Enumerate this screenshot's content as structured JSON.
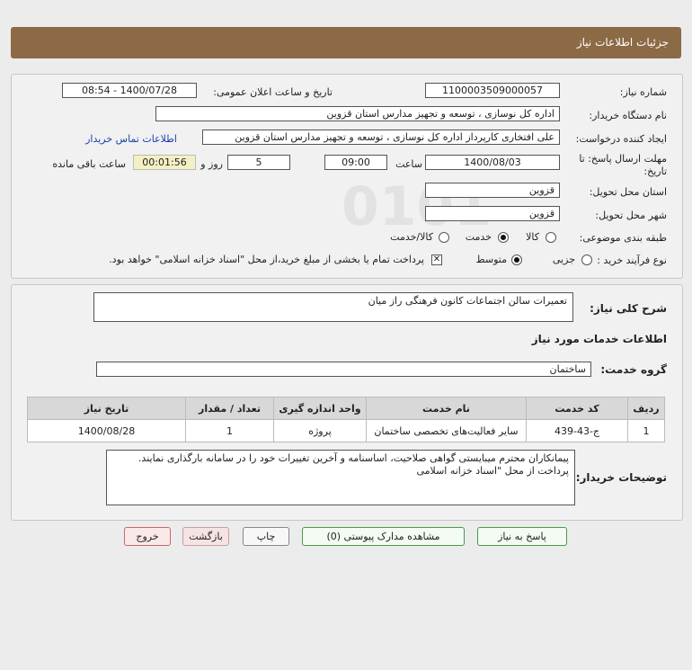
{
  "header": {
    "title": "جزئیات اطلاعات نیاز"
  },
  "form": {
    "need_number_label": "شماره نیاز:",
    "need_number": "1100003509000057",
    "announce_label": "تاریخ و ساعت اعلان عمومی:",
    "announce_value": "1400/07/28 - 08:54",
    "buyer_org_label": "نام دستگاه خریدار:",
    "buyer_org": "اداره کل نوسازی ، توسعه و تجهیز مدارس استان قزوین",
    "creator_label": "ایجاد کننده درخواست:",
    "creator": "علی افتخاری کارپرداز اداره کل نوسازی ، توسعه و تجهیز مدارس استان قزوین",
    "contact_link": "اطلاعات تماس خریدار",
    "deadline_label_1": "مهلت ارسال پاسخ: تا",
    "deadline_label_2": "تاریخ:",
    "deadline_date": "1400/08/03",
    "time_label": "ساعت",
    "deadline_time": "09:00",
    "days_value": "5",
    "days_label": "روز و",
    "remaining_time": "00:01:56",
    "remaining_label": "ساعت باقی مانده",
    "delivery_province_label": "استان محل تحویل:",
    "delivery_province": "قزوین",
    "delivery_city_label": "شهر محل تحویل:",
    "delivery_city": "قزوین",
    "category_label": "طبقه بندی موضوعی:",
    "category_options": [
      "کالا",
      "خدمت",
      "کالا/خدمت"
    ],
    "category_selected": "خدمت",
    "process_label": "نوع فرآیند خرید :",
    "process_options": [
      "جزیی",
      "متوسط"
    ],
    "process_selected": "متوسط",
    "payment_note": "پرداخت تمام یا بخشی از مبلغ خرید،از محل \"اسناد خزانه اسلامی\" خواهد بود."
  },
  "details": {
    "summary_label": "شرح کلی نیاز:",
    "summary": "تعمیرات سالن اجتماعات کانون فرهنگی راز میان",
    "services_heading": "اطلاعات خدمات مورد نیاز",
    "service_group_label": "گروه خدمت:",
    "service_group": "ساختمان",
    "table": {
      "headers": [
        "ردیف",
        "کد خدمت",
        "نام خدمت",
        "واحد اندازه گیری",
        "تعداد / مقدار",
        "تاریخ نیاز"
      ],
      "rows": [
        [
          "1",
          "ج-43-439",
          "سایر فعالیت‌های تخصصی ساختمان",
          "پروژه",
          "1",
          "1400/08/28"
        ]
      ]
    },
    "buyer_notes_label": "توضیحات خریدار:",
    "buyer_notes": [
      "پیمانکاران محترم میبایستی گواهی صلاحیت، اساسنامه و آخرین تغییرات خود را در سامانه بارگذاری نمایند.",
      "پرداخت از محل \"اسناد خزانه اسلامی"
    ]
  },
  "buttons": {
    "reply": "پاسخ به نیاز",
    "view_docs": "مشاهده مدارک پیوستی (0)",
    "print": "چاپ",
    "back": "بازگشت",
    "exit": "خروج"
  },
  "watermark": {
    "line1": "ParsNamadData",
    "line2": "۰۲۱-۸۸۳۴۹۶۷۰-۵"
  }
}
